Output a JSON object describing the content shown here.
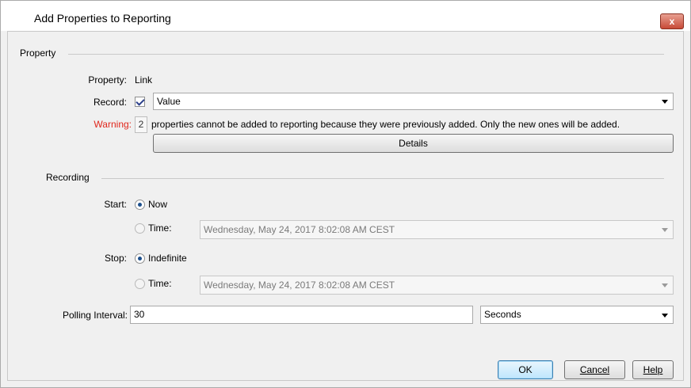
{
  "window": {
    "title": "Add Properties to Reporting",
    "close_glyph": "x"
  },
  "property_section": {
    "heading": "Property",
    "property_label": "Property:",
    "property_value": "Link",
    "record_label": "Record:",
    "record_checked": true,
    "record_value": "Value",
    "warning_label": "Warning:",
    "warning_count": "2",
    "warning_text": "properties cannot be added to reporting because they were previously added. Only the new ones will be added.",
    "details_button": "Details"
  },
  "recording_section": {
    "heading": "Recording",
    "start_label": "Start:",
    "start_now": "Now",
    "start_time": "Time:",
    "start_time_value": "Wednesday, May 24, 2017 8:02:08 AM CEST",
    "stop_label": "Stop:",
    "stop_indefinite": "Indefinite",
    "stop_time": "Time:",
    "stop_time_value": "Wednesday, May 24, 2017 8:02:08 AM CEST"
  },
  "polling": {
    "label": "Polling Interval:",
    "value": "30",
    "unit": "Seconds"
  },
  "buttons": {
    "ok": "OK",
    "cancel": "Cancel",
    "help": "Help"
  },
  "colors": {
    "warning": "#e0261b",
    "accent": "#3c7fb1"
  }
}
